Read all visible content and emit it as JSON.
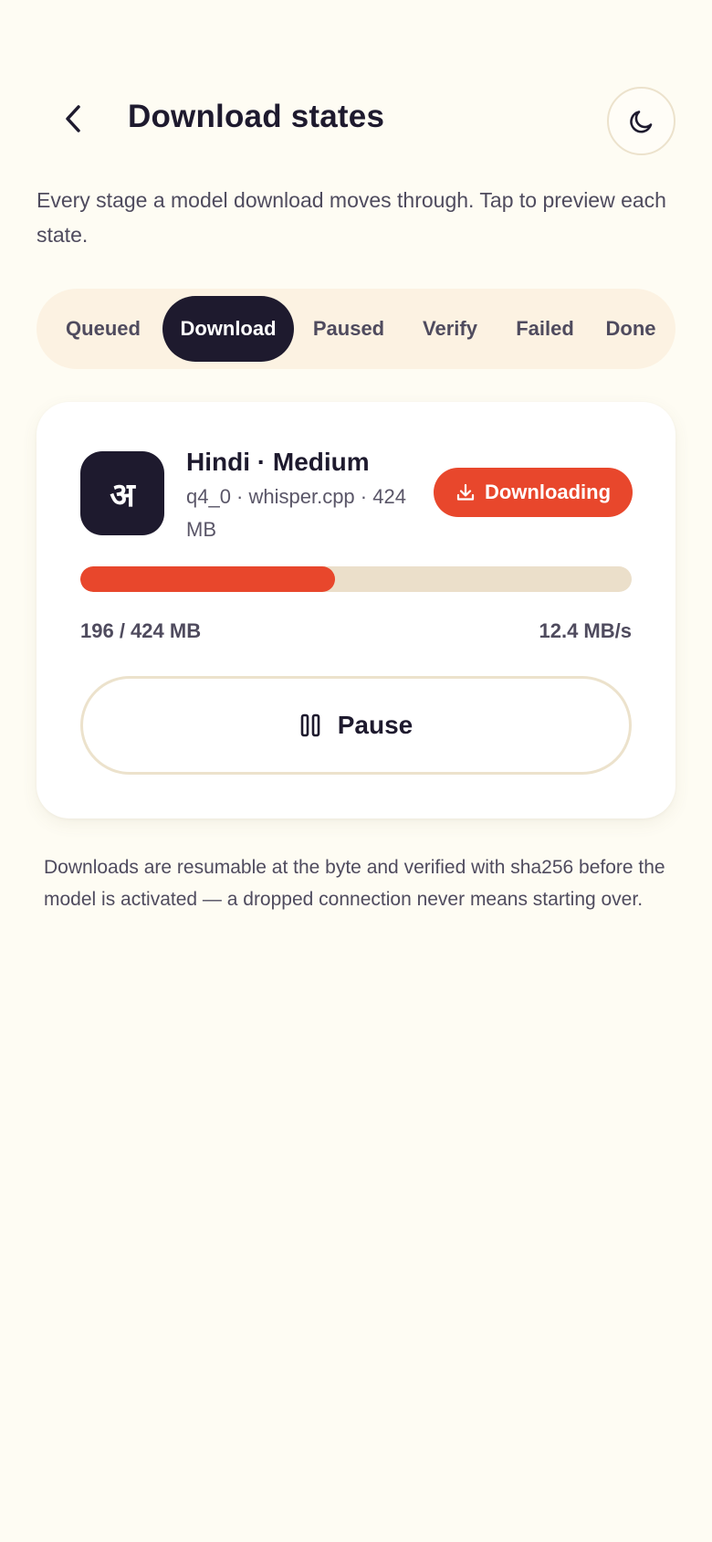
{
  "header": {
    "title": "Download states",
    "back_icon": "chevron-left-icon",
    "theme_icon": "moon-icon"
  },
  "subtitle": "Every stage a model download moves through. Tap to preview each state.",
  "tabs": [
    {
      "label": "Queued",
      "active": false
    },
    {
      "label": "Download",
      "active": true
    },
    {
      "label": "Paused",
      "active": false
    },
    {
      "label": "Verify",
      "active": false
    },
    {
      "label": "Failed",
      "active": false
    },
    {
      "label": "Done",
      "active": false
    }
  ],
  "card": {
    "icon_glyph": "अ",
    "model_name": "Hindi · Medium",
    "model_meta": "q4_0 · whisper.cpp · 424 MB",
    "status_label": "Downloading",
    "status_icon": "download-icon",
    "progress_fraction": 0.462,
    "size_text": "196 / 424 MB",
    "speed_text": "12.4 MB/s",
    "pause_label": "Pause",
    "pause_icon": "pause-icon"
  },
  "footnote": "Downloads are resumable at the byte and verified with sha256 before the model is activated — a dropped connection never means starting over.",
  "colors": {
    "background": "#fefcf3",
    "accent": "#e8472c",
    "dark": "#1e1a2e",
    "track": "#ebdfca",
    "tabs_bg": "#fcf2e2"
  }
}
